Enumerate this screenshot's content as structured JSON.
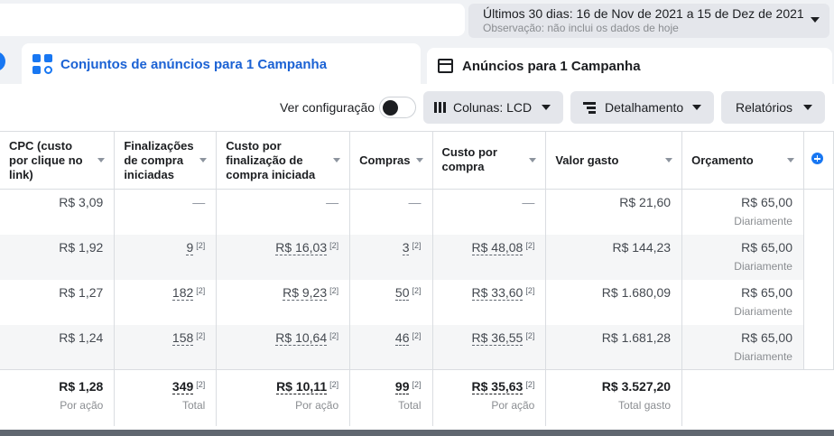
{
  "date_range": {
    "main": "Últimos 30 dias: 16 de Nov de 2021 a 15 de Dez de 2021",
    "note": "Observação: não inclui os dados de hoje"
  },
  "tabs": {
    "active": "Conjuntos de anúncios para 1 Campanha",
    "inactive": "Anúncios para 1 Campanha"
  },
  "toolbar": {
    "view_config_label": "Ver configuração",
    "columns_label": "Colunas: LCD",
    "breakdown_label": "Detalhamento",
    "reports_label": "Relatórios"
  },
  "columns": [
    "CPC (custo por clique no link)",
    "Finalizações de compra iniciadas",
    "Custo por finalização de compra iniciada",
    "Compras",
    "Custo por compra",
    "Valor gasto",
    "Orçamento"
  ],
  "rows": [
    {
      "cpc": "R$ 3,09",
      "checkouts": "—",
      "cost_checkout": "—",
      "purchases": "—",
      "cost_purchase": "—",
      "spent": "R$ 21,60",
      "budget": "R$ 65,00",
      "budget_sub": "Diariamente"
    },
    {
      "cpc": "R$ 1,92",
      "checkouts": "9",
      "cost_checkout": "R$ 16,03",
      "purchases": "3",
      "cost_purchase": "R$ 48,08",
      "spent": "R$ 144,23",
      "budget": "R$ 65,00",
      "budget_sub": "Diariamente"
    },
    {
      "cpc": "R$ 1,27",
      "checkouts": "182",
      "cost_checkout": "R$ 9,23",
      "purchases": "50",
      "cost_purchase": "R$ 33,60",
      "spent": "R$ 1.680,09",
      "budget": "R$ 65,00",
      "budget_sub": "Diariamente"
    },
    {
      "cpc": "R$ 1,24",
      "checkouts": "158",
      "cost_checkout": "R$ 10,64",
      "purchases": "46",
      "cost_purchase": "R$ 36,55",
      "spent": "R$ 1.681,28",
      "budget": "R$ 65,00",
      "budget_sub": "Diariamente"
    }
  ],
  "footnote_marker": "[2]",
  "totals": {
    "cpc": "R$ 1,28",
    "cpc_sub": "Por ação",
    "checkouts": "349",
    "checkouts_sub": "Total",
    "cost_checkout": "R$ 10,11",
    "cost_checkout_sub": "Por ação",
    "purchases": "99",
    "purchases_sub": "Total",
    "cost_purchase": "R$ 35,63",
    "cost_purchase_sub": "Por ação",
    "spent": "R$ 3.527,20",
    "spent_sub": "Total gasto"
  },
  "icons": {
    "date_caret": "chevron-down-icon",
    "active_tab": "ad-sets-grid-icon",
    "inactive_tab": "ad-window-icon",
    "columns": "columns-icon",
    "breakdown": "breakdown-icon",
    "add_column": "plus-circle-icon"
  },
  "colors": {
    "accent": "#1877f2",
    "active_tab_text": "#1b62d4"
  }
}
